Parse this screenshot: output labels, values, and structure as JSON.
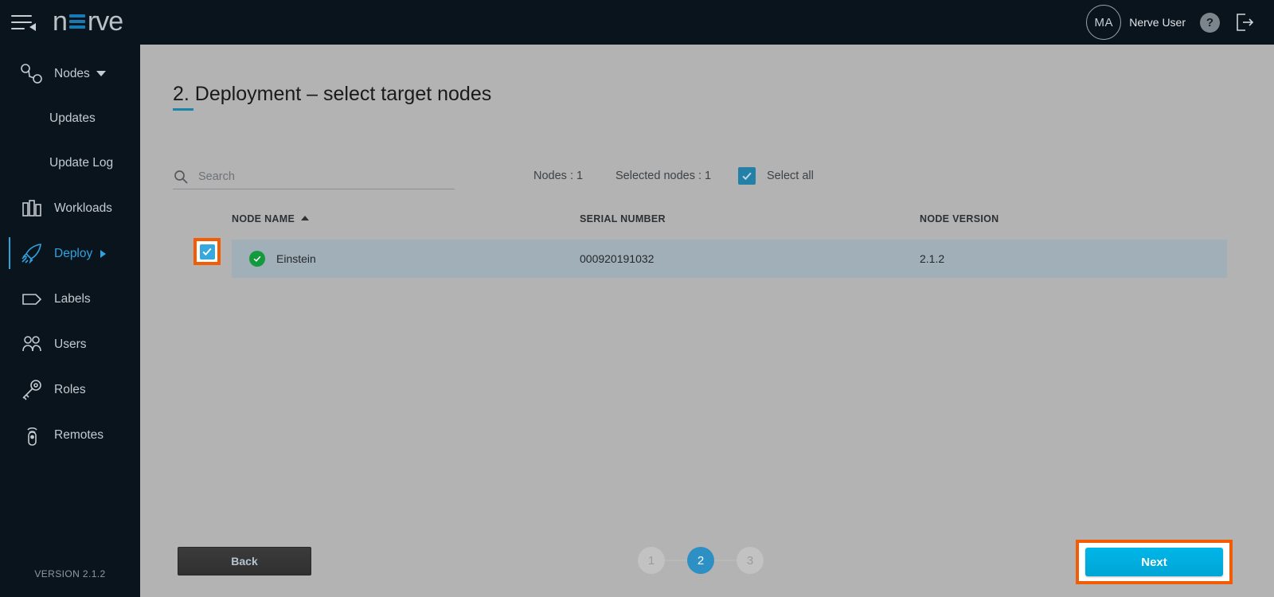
{
  "topbar": {
    "menu_icon": "hamburger-icon",
    "logo_text_left": "n",
    "logo_e": "E",
    "logo_text_right": "rve",
    "avatar_initials": "MA",
    "user_name": "Nerve User",
    "help_icon_label": "?",
    "logout_icon": "logout-icon"
  },
  "sidebar": {
    "items": [
      {
        "label": "Nodes",
        "icon": "nodes-icon",
        "has_caret_down": true,
        "active": false
      },
      {
        "label": "Updates",
        "icon": "",
        "sub": true,
        "active": false
      },
      {
        "label": "Update Log",
        "icon": "",
        "sub": true,
        "active": false
      },
      {
        "label": "Workloads",
        "icon": "workloads-icon",
        "active": false
      },
      {
        "label": "Deploy",
        "icon": "rocket-icon",
        "has_caret_right": true,
        "active": true
      },
      {
        "label": "Labels",
        "icon": "tag-icon",
        "active": false
      },
      {
        "label": "Users",
        "icon": "users-icon",
        "active": false
      },
      {
        "label": "Roles",
        "icon": "key-icon",
        "active": false
      },
      {
        "label": "Remotes",
        "icon": "remote-icon",
        "active": false
      }
    ],
    "version": "VERSION 2.1.2"
  },
  "main": {
    "page_title": "2. Deployment – select target nodes",
    "search": {
      "value": "",
      "placeholder": "Search",
      "icon": "search-icon"
    },
    "counts": {
      "nodes": "Nodes : 1",
      "selected": "Selected nodes : 1"
    },
    "select_all": {
      "label": "Select all",
      "checked": true
    },
    "table": {
      "columns": [
        "NODE NAME",
        "SERIAL NUMBER",
        "NODE VERSION"
      ],
      "sort_column": "NODE NAME",
      "sort_direction": "asc",
      "rows": [
        {
          "checked": true,
          "status": "online",
          "node_name": "Einstein",
          "serial_number": "000920191032",
          "node_version": "2.1.2"
        }
      ]
    }
  },
  "footer": {
    "back_label": "Back",
    "next_label": "Next",
    "steps": [
      "1",
      "2",
      "3"
    ],
    "active_step": "2"
  },
  "colors": {
    "accent_blue": "#2da3e0",
    "logo_blue": "#1879b3",
    "next_blue": "#00a5d4",
    "annotation_orange": "#f25c05",
    "status_green": "#139a3c",
    "row_highlight": "#a0afb8",
    "sidebar_bg": "#0a141d",
    "page_bg": "#b3b3b3"
  }
}
